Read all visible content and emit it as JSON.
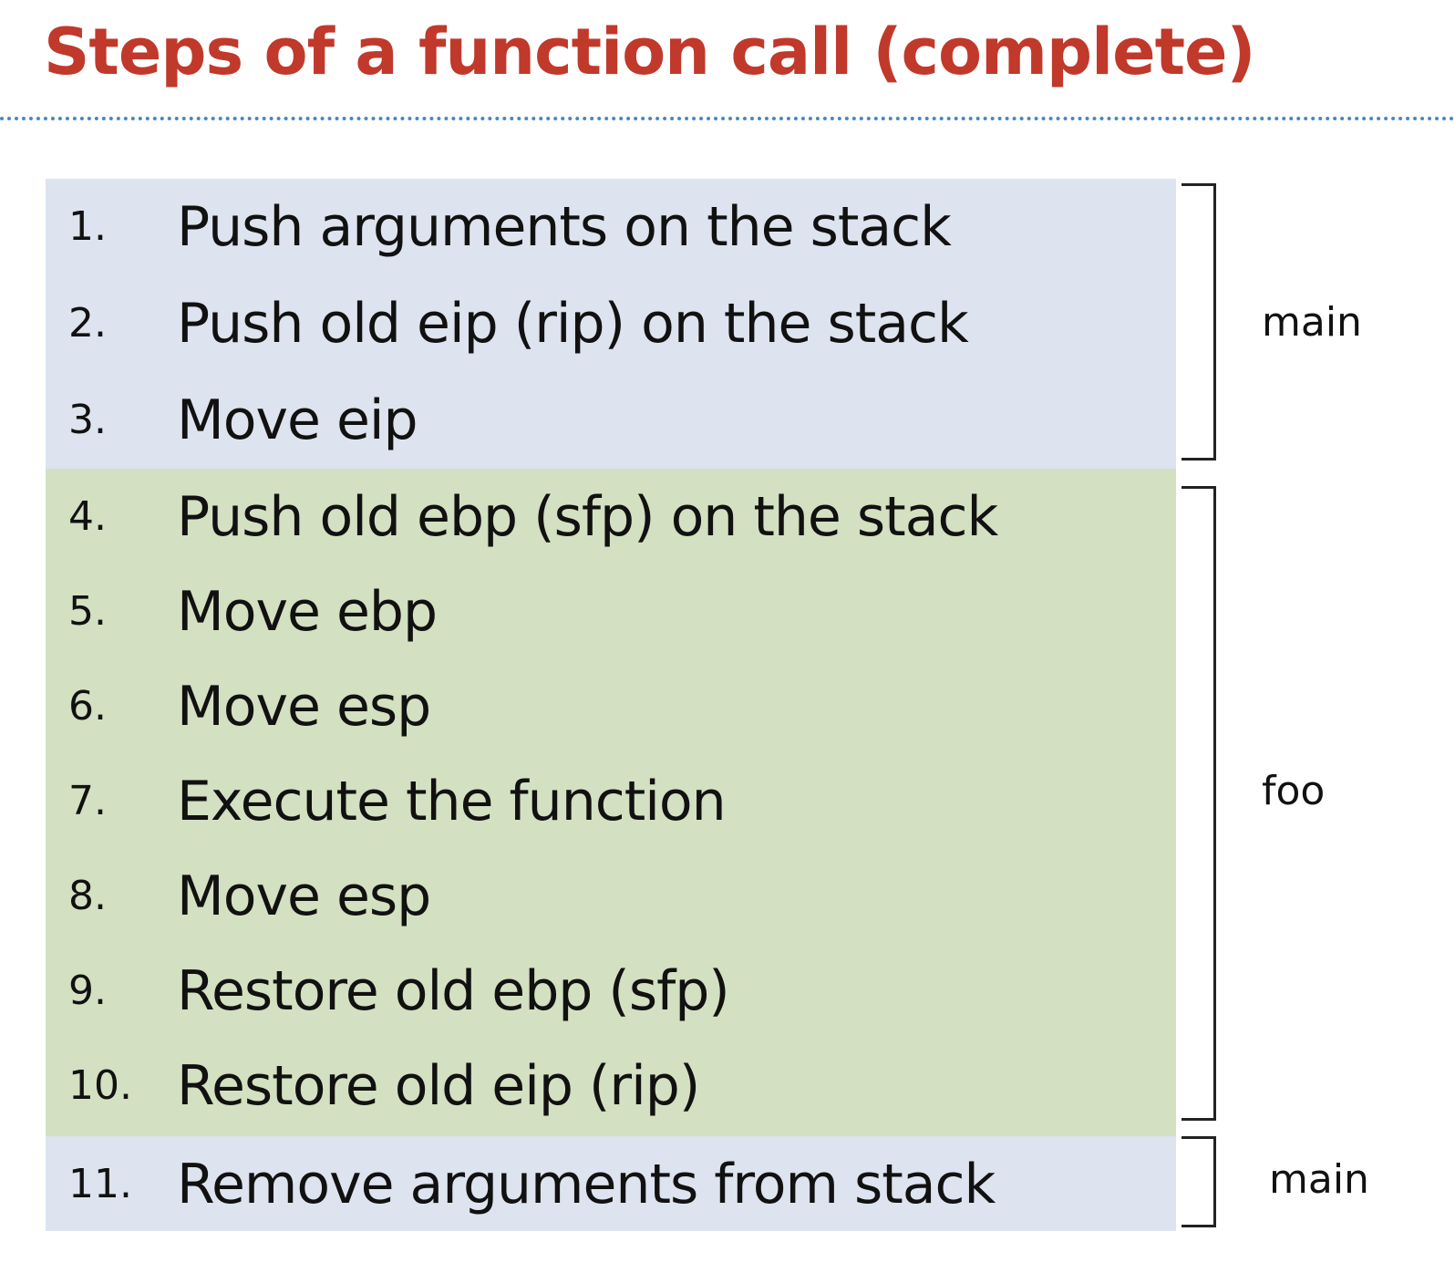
{
  "title": "Steps of a function call (complete)",
  "groups": [
    {
      "label": "main",
      "steps": [
        {
          "num": "1.",
          "text": "Push arguments on the stack"
        },
        {
          "num": "2.",
          "text": "Push old eip (rip) on the stack"
        },
        {
          "num": "3.",
          "text": "Move eip"
        }
      ]
    },
    {
      "label": "foo",
      "steps": [
        {
          "num": "4.",
          "text": "Push old ebp (sfp) on the stack"
        },
        {
          "num": "5.",
          "text": "Move ebp"
        },
        {
          "num": "6.",
          "text": "Move esp"
        },
        {
          "num": "7.",
          "text": "Execute the function"
        },
        {
          "num": "8.",
          "text": "Move esp"
        },
        {
          "num": "9.",
          "text": "Restore old ebp (sfp)"
        },
        {
          "num": "10.",
          "text": "Restore old eip (rip)"
        }
      ]
    },
    {
      "label": "main",
      "steps": [
        {
          "num": "11.",
          "text": "Remove arguments from stack"
        }
      ]
    }
  ],
  "colors": {
    "title": "#c0392b",
    "main_band": "#dde3ef",
    "foo_band": "#d3e0c1",
    "divider": "#4a86c5"
  }
}
